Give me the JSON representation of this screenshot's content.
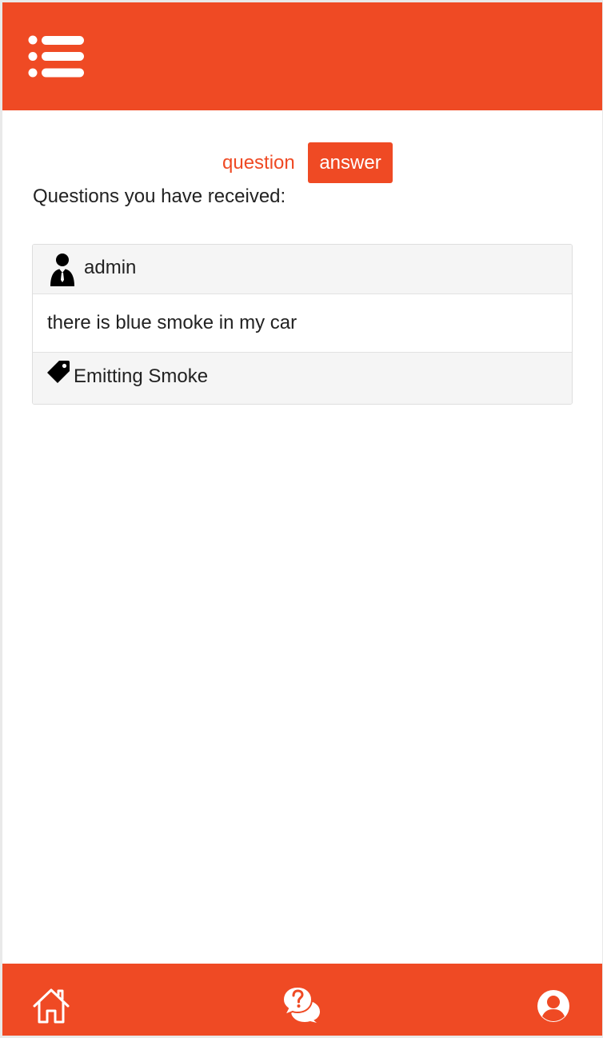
{
  "theme": {
    "accent": "#ef4a24",
    "background": "#ffffff",
    "card_header_bg": "#f5f5f5"
  },
  "header": {
    "menu_icon": "list-menu-icon"
  },
  "tabs": {
    "question_label": "question",
    "answer_label": "answer",
    "active": "answer"
  },
  "main": {
    "heading": "Questions you have received:",
    "cards": [
      {
        "user_icon": "user-icon",
        "username": "admin",
        "question": "there is blue smoke in my car",
        "tag_icon": "tag-icon",
        "tag": "Emitting Smoke"
      }
    ]
  },
  "bottom_nav": {
    "items": [
      {
        "icon": "home-icon"
      },
      {
        "icon": "question-chat-icon"
      },
      {
        "icon": "user-circle-icon"
      }
    ]
  }
}
